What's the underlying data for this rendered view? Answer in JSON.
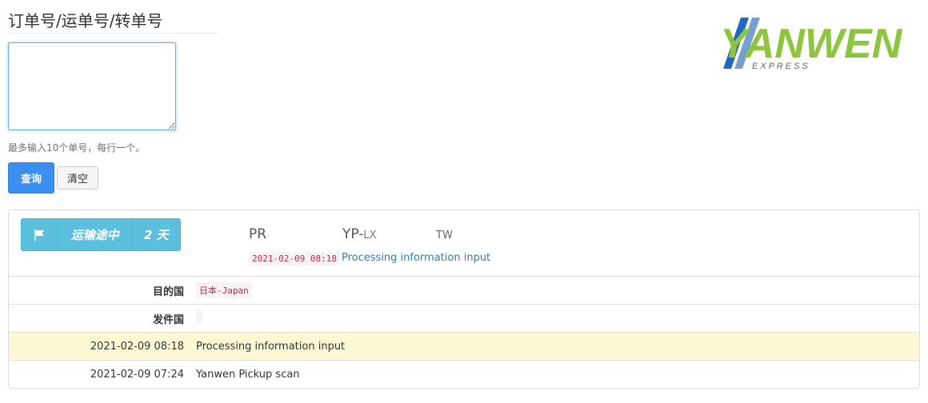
{
  "form": {
    "title": "订单号/运单号/转单号",
    "textarea_value": "",
    "help_text": "最多输入10个单号，每行一个。",
    "query_label": "查询",
    "clear_label": "清空"
  },
  "logo": {
    "brand": "YANWEN",
    "tagline": "E X P R E S S",
    "colors": {
      "green": "#8cc63f",
      "blue": "#1f5fb4"
    }
  },
  "result": {
    "status_icon": "flag-icon",
    "status_label": "运输途中",
    "days": "2 天",
    "origin": "PR",
    "product_main": "YP-",
    "product_sub": "LX",
    "destination_code": "TW",
    "latest_time": "2021-02-09 08:18",
    "latest_event": "Processing information input",
    "destination_label": "目的国",
    "destination_value": "日本-Japan",
    "origin_label": "发件国",
    "origin_value": "",
    "events": [
      {
        "time": "2021-02-09 08:18",
        "desc": "Processing information input"
      },
      {
        "time": "2021-02-09 07:24",
        "desc": "Yanwen Pickup scan"
      }
    ]
  },
  "colors": {
    "primary": "#3b8ff0",
    "info": "#5bc0de",
    "highlight_row": "#fcf8d3",
    "code_text": "#c7254e"
  }
}
